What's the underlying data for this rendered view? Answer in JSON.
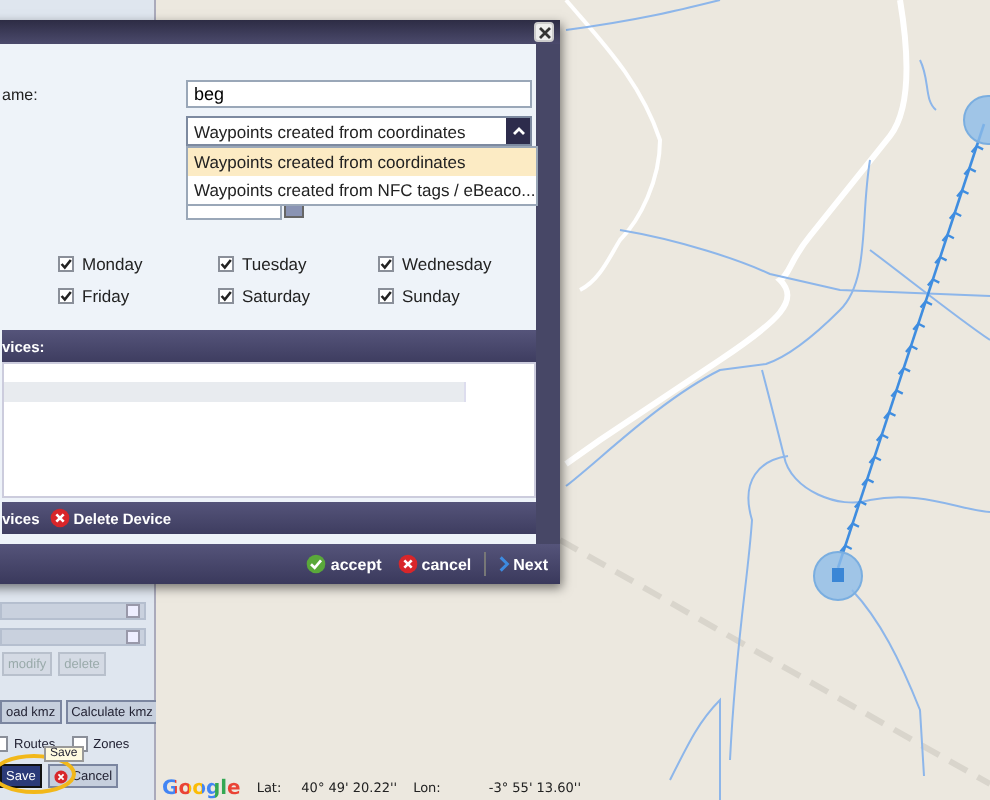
{
  "dialog": {
    "name_label": "ame:",
    "name_value": "beg",
    "type_select": {
      "value": "Waypoints created from coordinates",
      "expanded": true,
      "options": [
        {
          "label": "Waypoints created from coordinates",
          "selected": true
        },
        {
          "label": "Waypoints created from NFC tags / eBeaco...",
          "selected": false
        }
      ]
    },
    "days": [
      {
        "label": "Monday",
        "checked": true
      },
      {
        "label": "Tuesday",
        "checked": true
      },
      {
        "label": "Wednesday",
        "checked": true
      },
      {
        "label": "Friday",
        "checked": true
      },
      {
        "label": "Saturday",
        "checked": true
      },
      {
        "label": "Sunday",
        "checked": true
      }
    ],
    "devices_header": "vices:",
    "devices_toolbar": [
      {
        "kind": "text",
        "label": "vices"
      },
      {
        "kind": "delete",
        "label": "Delete Device"
      }
    ],
    "footer_buttons": [
      {
        "kind": "accept",
        "label": "accept"
      },
      {
        "kind": "cancel",
        "label": "cancel"
      },
      {
        "kind": "next",
        "label": "Next"
      }
    ]
  },
  "side_panel": {
    "actions": [
      {
        "label": "modify",
        "disabled": true
      },
      {
        "label": "delete",
        "disabled": true
      }
    ],
    "kmz_buttons": [
      "oad kmz",
      "Calculate kmz"
    ],
    "layers": [
      {
        "label": "Routes",
        "checked": false
      },
      {
        "label": "Zones",
        "checked": false
      }
    ],
    "form_buttons": [
      {
        "kind": "save",
        "label": "Save"
      },
      {
        "kind": "cancel",
        "label": "Cancel"
      }
    ],
    "tooltip": "Save"
  },
  "map": {
    "logo": "Google",
    "lat_label": "Lat:",
    "lat": "40° 49' 20.22''",
    "lon_label": "Lon:",
    "lon": "-3° 55' 13.60''"
  }
}
